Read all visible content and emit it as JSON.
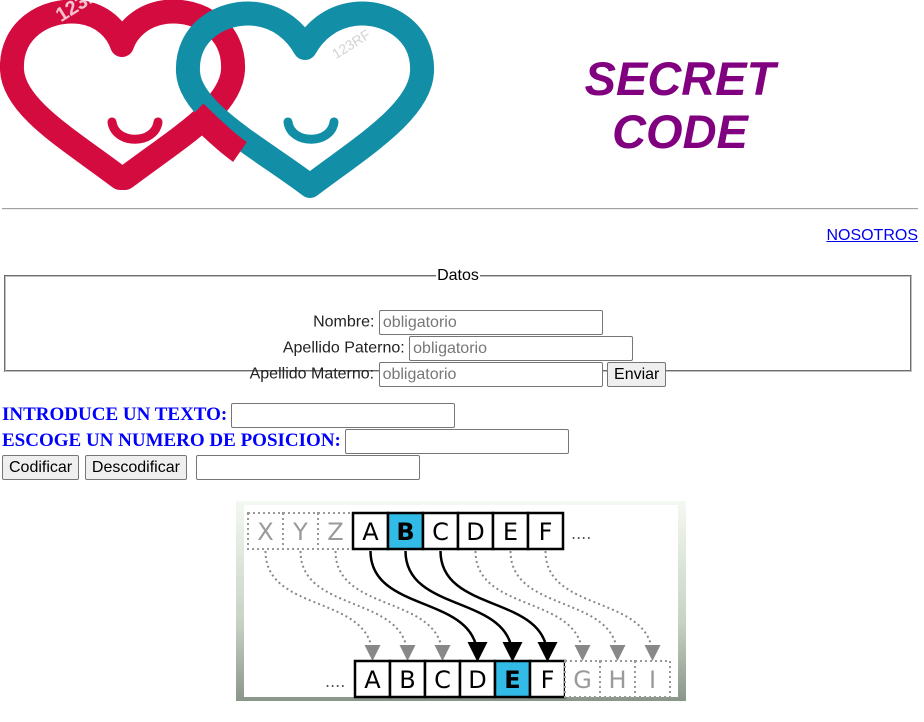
{
  "header": {
    "title_line1": "SECRET",
    "title_line2": "CODE",
    "title_color": "#800080",
    "logo_colors": {
      "left_heart": "#d30b3f",
      "right_heart": "#138ea7"
    },
    "watermark": "123RF"
  },
  "nav": {
    "nosotros_label": "NOSOTROS"
  },
  "datos_form": {
    "legend": "Datos",
    "nombre_label": "Nombre:",
    "nombre_placeholder": "obligatorio",
    "paterno_label": "Apellido Paterno:",
    "paterno_placeholder": "obligatorio",
    "materno_label": "Apellido Materno:",
    "materno_placeholder": "obligatorio",
    "submit_label": "Enviar"
  },
  "cipher_form": {
    "text_label": "INTRODUCE UN TEXTO:",
    "text_value": "",
    "position_label": "ESCOGE UN NUMERO DE POSICION:",
    "position_value": "",
    "encode_label": "Codificar",
    "decode_label": "Descodificar",
    "result_value": ""
  },
  "diagram": {
    "top_row_faded": [
      "X",
      "Y",
      "Z"
    ],
    "top_row": [
      "A",
      "B",
      "C",
      "D",
      "E",
      "F"
    ],
    "top_highlight": "B",
    "bottom_row": [
      "A",
      "B",
      "C",
      "D",
      "E",
      "F"
    ],
    "bottom_row_faded": [
      "G",
      "H",
      "I"
    ],
    "bottom_highlight": "E",
    "ellipsis": "....",
    "highlight_color": "#33bbe8"
  }
}
